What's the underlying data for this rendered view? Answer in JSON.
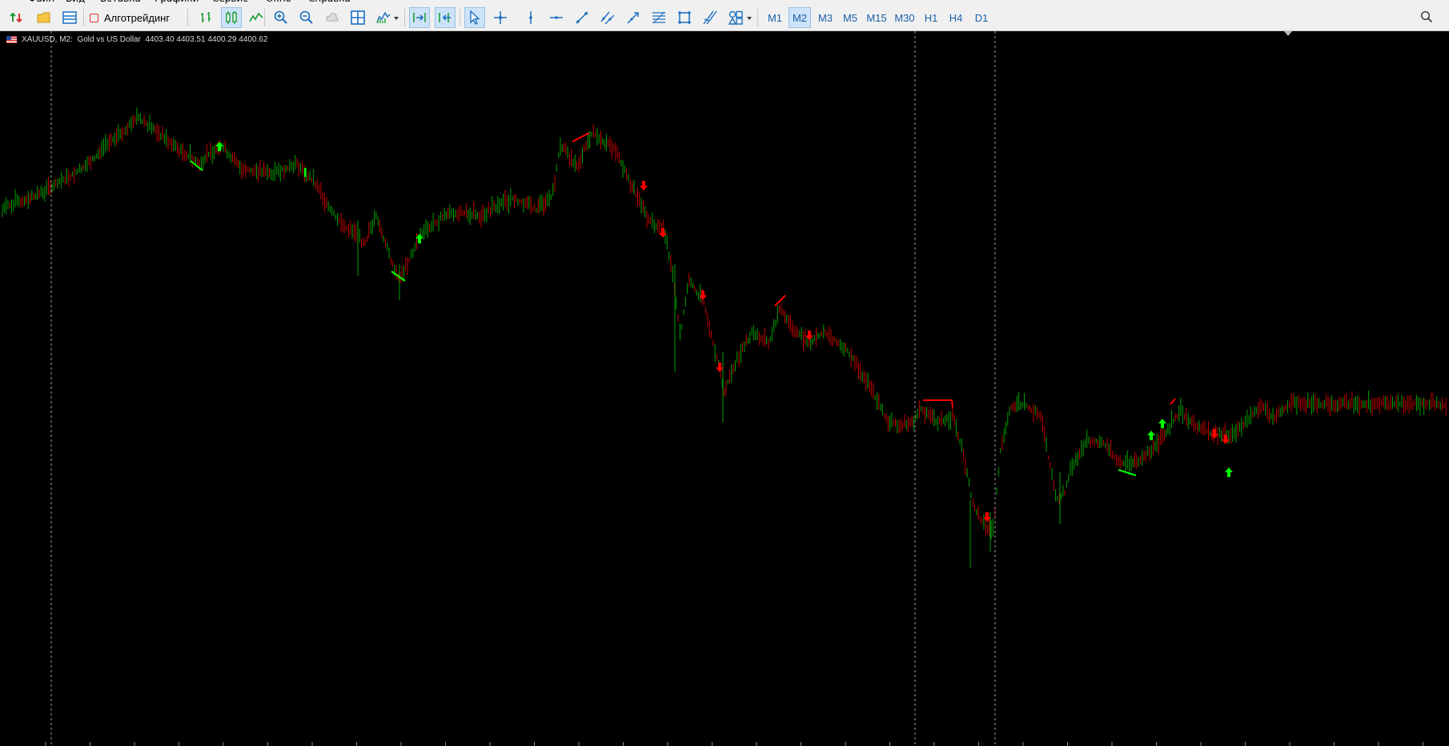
{
  "menu": {
    "items": [
      "Файл",
      "Вид",
      "Вставка",
      "Графики",
      "Сервис",
      "Окно",
      "Справка"
    ]
  },
  "toolbar": {
    "algo_trading_label": "Алготрейдинг",
    "left_icons": [
      "new-order-icon",
      "open-folder-icon",
      "profiles-icon"
    ],
    "chart_type_icons": [
      "bar-chart-icon",
      "candlestick-icon",
      "line-chart-icon"
    ],
    "zoom_icons": [
      "zoom-in-icon",
      "zoom-out-icon",
      "cloud-icon",
      "tile-windows-icon",
      "indicators-icon"
    ],
    "scroll_icons": [
      "auto-scroll-icon",
      "chart-shift-icon"
    ],
    "drawing_icons": [
      "cursor-icon",
      "crosshair-icon",
      "vertical-line-icon",
      "horizontal-line-icon",
      "trend-line-icon",
      "channel-icon",
      "arrowed-line-icon",
      "fibonacci-icon",
      "rectangle-icon",
      "pitchfork-icon",
      "shapes-icon"
    ],
    "timeframes": [
      "M1",
      "M2",
      "M3",
      "M5",
      "M15",
      "M30",
      "H1",
      "H4",
      "D1"
    ],
    "active_timeframe": "M2",
    "search_icon": "search-icon"
  },
  "chart": {
    "symbol_line": "XAUUSD, M2:  Gold vs US Dollar  4403.40 4403.51 4400.29 4400.62",
    "background": "#000000",
    "bull_color": "#00a000",
    "bear_color": "#c00000",
    "buy_arrow_color": "#00ff00",
    "sell_arrow_color": "#ff0000"
  },
  "chart_data": {
    "type": "candlestick",
    "symbol": "XAUUSD",
    "timeframe": "M2",
    "last_bar": {
      "open": 4403.4,
      "high": 4403.51,
      "low": 4400.29,
      "close": 4400.62
    },
    "buy_signals": 6,
    "sell_signals": 10,
    "period_separators": 3
  }
}
